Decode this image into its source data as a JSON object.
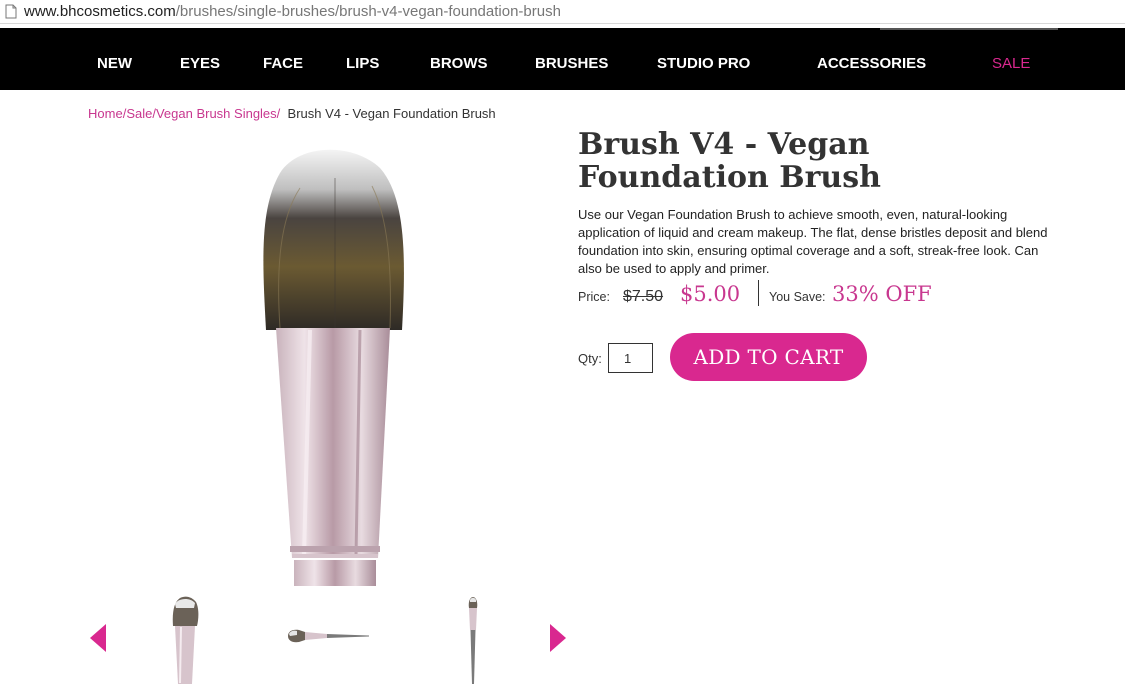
{
  "browser": {
    "url_host": "www.bhcosmetics.com",
    "url_path": "/brushes/single-brushes/brush-v4-vegan-foundation-brush"
  },
  "nav": {
    "items": [
      "NEW",
      "EYES",
      "FACE",
      "LIPS",
      "BROWS",
      "BRUSHES",
      "STUDIO PRO",
      "ACCESSORIES",
      "SALE"
    ],
    "sale_color": "#d9288f"
  },
  "breadcrumb": {
    "items": [
      "Home",
      "Sale",
      "Vegan Brush Singles"
    ],
    "current": "Brush V4 - Vegan Foundation Brush"
  },
  "product": {
    "title": "Brush V4 - Vegan Foundation Brush",
    "description": "Use our Vegan Foundation Brush to achieve smooth, even, natural-looking application of liquid and cream makeup. The flat, dense bristles deposit and blend foundation into skin, ensuring optimal coverage and a soft, streak-free look. Can also be used to apply and primer.",
    "price_label": "Price:",
    "old_price": "$7.50",
    "new_price": "$5.00",
    "save_label": "You Save:",
    "save_value": "33% OFF",
    "qty_label": "Qty:",
    "qty_value": "1",
    "add_to_cart_label": "ADD TO CART"
  },
  "gallery": {
    "thumbnails": [
      "front-view",
      "side-view",
      "full-length-view"
    ],
    "prev_icon": "triangle-left-icon",
    "next_icon": "triangle-right-icon"
  },
  "colors": {
    "accent": "#d9288f",
    "link": "#c8378f",
    "nav_background": "#000000"
  }
}
